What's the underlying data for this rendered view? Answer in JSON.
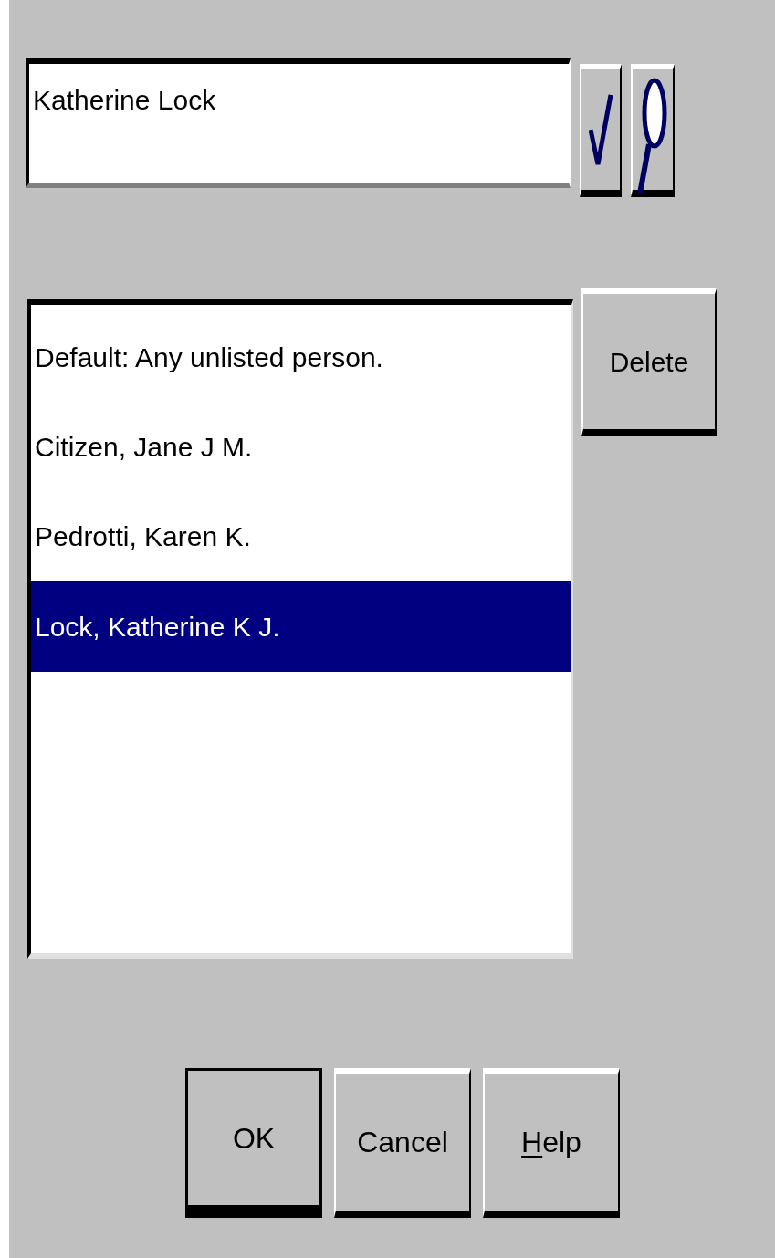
{
  "name_field": {
    "value": "Katherine Lock"
  },
  "list": {
    "items": [
      {
        "label": "Default: Any unlisted person.",
        "selected": false
      },
      {
        "label": "Citizen, Jane J M.",
        "selected": false
      },
      {
        "label": "Pedrotti, Karen K.",
        "selected": false
      },
      {
        "label": "Lock, Katherine K J.",
        "selected": true
      }
    ]
  },
  "buttons": [
    {
      "label": "OK",
      "default": true,
      "mnemonic": false
    },
    {
      "label": "Cancel",
      "default": false,
      "mnemonic": false
    },
    {
      "label": "Help",
      "default": false,
      "mnemonic": true
    }
  ],
  "delete_button": {
    "label": "Delete"
  }
}
